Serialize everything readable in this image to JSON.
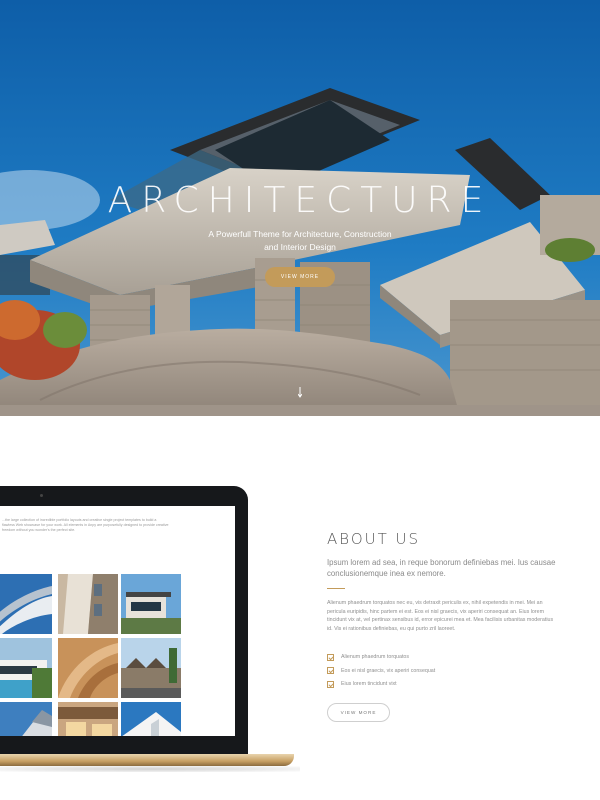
{
  "hero": {
    "title": "ARCHITECTURE",
    "subtitle_line1": "A Powerfull Theme for Architecture, Construction",
    "subtitle_line2": "and Interior Design",
    "button_label": "VIEW MORE"
  },
  "laptop": {
    "screen_text": "...the large collection of incredible portfolio layouts and creative single project templates to build a flawless Web showcase for your work. All elements in Anpy are purposefully designed to provide creative freedom without you wonder's the perfect site.",
    "thumbnail_icons": [
      "curved-facade",
      "angled-panels",
      "modern-house",
      "white-villa-pool",
      "wood-interior",
      "townhouses",
      "facade-detail",
      "house-dusk",
      "white-wall"
    ]
  },
  "about": {
    "title": "ABOUT US",
    "lead": "Ipsum lorem ad sea, in reque bonorum definiebas mei. Ius causae conclusionemque inea ex nemore.",
    "body": "Alienum phaedrum torquatos nec eu, vis detraxit periculis ex, nihil expetendis in mei. Mei an pericula euripidis, hinc partem ei est. Eos ei nisl graecis, vix aperiri consequat an. Eius lorem tincidunt vix at, vel pertinax sensibus id, error epicurei mea et. Mea facilisis urbanitas moderatius id. Vis ei rationibus definiebas, eu qui purto zril laoreet.",
    "checklist": [
      "Alienum phaedrum torquatos",
      "Eos ei nisl graecis, vix aperiri consequat",
      "Eius lorem tincidunt vixt"
    ],
    "button_label": "VIEW MORE"
  },
  "colors": {
    "accent": "#c39b5a",
    "sky": "#1a6fb5",
    "laptop_frame": "#16181b"
  }
}
